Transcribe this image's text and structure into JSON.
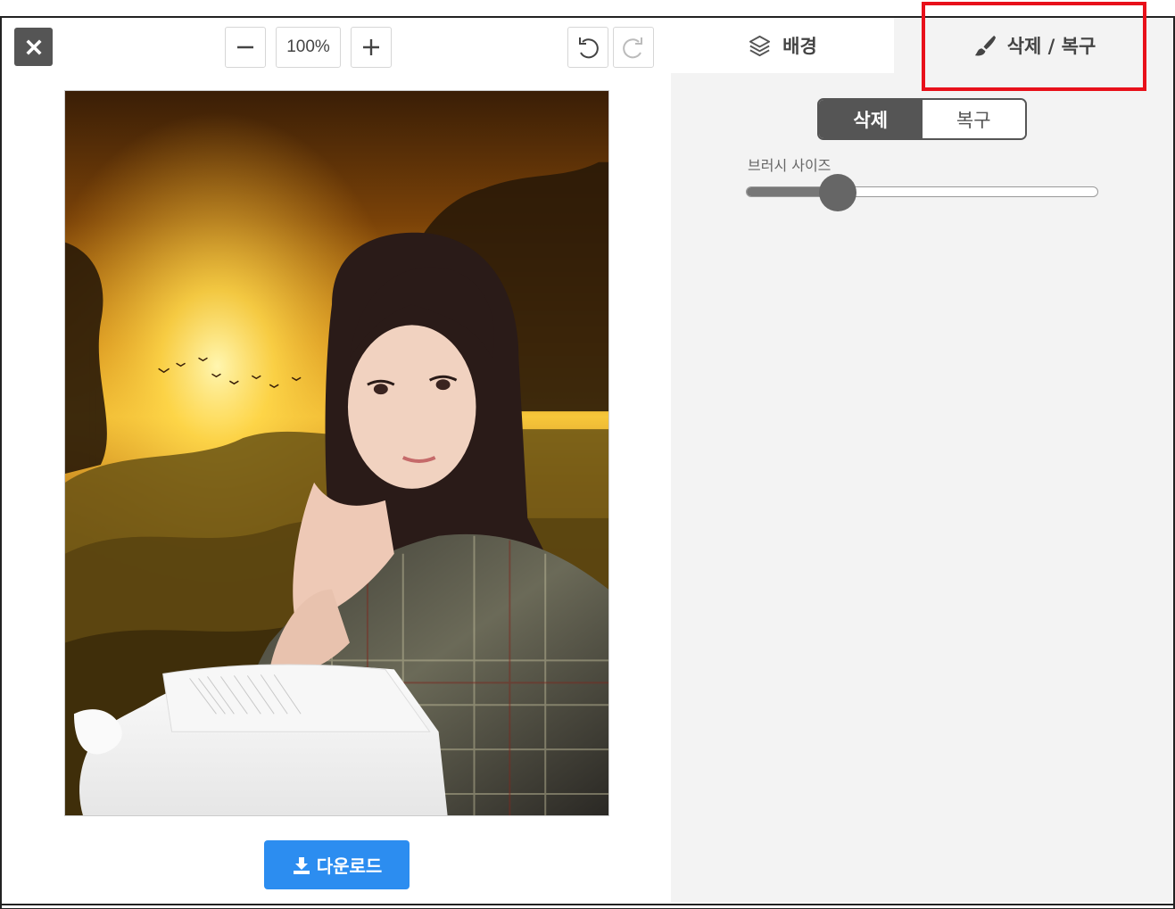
{
  "toolbar": {
    "zoom_level": "100%"
  },
  "tabs": {
    "background_label": "배경",
    "erase_restore_label": "삭제 / 복구"
  },
  "panel": {
    "mode_erase": "삭제",
    "mode_restore": "복구",
    "brush_size_label": "브러시 사이즈",
    "brush_size_fraction": 0.26
  },
  "download": {
    "label": "다운로드"
  },
  "colors": {
    "accent": "#2c8df0",
    "highlight": "#e8101a",
    "dark": "#555555"
  },
  "icons": {
    "close": "close-icon",
    "zoom_out": "minus-icon",
    "zoom_in": "plus-icon",
    "undo": "undo-icon",
    "redo": "redo-icon",
    "background": "layers-icon",
    "erase": "brush-icon",
    "download": "download-icon"
  }
}
